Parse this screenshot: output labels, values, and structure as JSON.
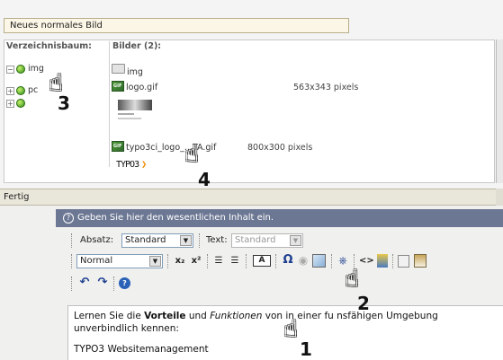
{
  "popup": {
    "title": "Neues normales Bild",
    "tree_header": "Verzeichnisbaum:",
    "files_header": "Bilder (2):",
    "tree": [
      {
        "toggle": "−",
        "label": "img"
      },
      {
        "toggle": "+",
        "label": "pc"
      },
      {
        "toggle": "+",
        "label": ""
      }
    ],
    "files": [
      {
        "name": "img",
        "dims": ""
      },
      {
        "name": "logo.gif",
        "dims": "563x343 pixels"
      },
      {
        "name": "typo3ci_logo_...TA.gif",
        "dims": "800x300 pixels",
        "thumb_text": "TYPO3"
      }
    ]
  },
  "status": {
    "text": "Fertig"
  },
  "editor": {
    "help_text": "Geben Sie hier den wesentlichen Inhalt ein.",
    "toolbar1": {
      "absatz_label": "Absatz:",
      "absatz_value": "Standard",
      "text_label": "Text:",
      "text_value": "Standard"
    },
    "toolbar2": {
      "style_value": "Normal",
      "subscript": "x₂",
      "superscript": "x²",
      "ordered_list": "☰",
      "unordered_list": "☰",
      "text_box": "A",
      "omega": "Ω",
      "find": "🔭",
      "source": "<>"
    },
    "content": {
      "line1_a": "Lernen Sie die ",
      "line1_bold": "Vorteile",
      "line1_b": " und ",
      "line1_italic": "Funktionen",
      "line1_c": " von   in einer fu   nsfähigen Umgebung",
      "line2": "unverbindlich kennen:",
      "line3": "TYPO3 Websitemanagement"
    }
  },
  "annotations": {
    "n1": "1",
    "n2": "2",
    "n3": "3",
    "n4": "4"
  }
}
